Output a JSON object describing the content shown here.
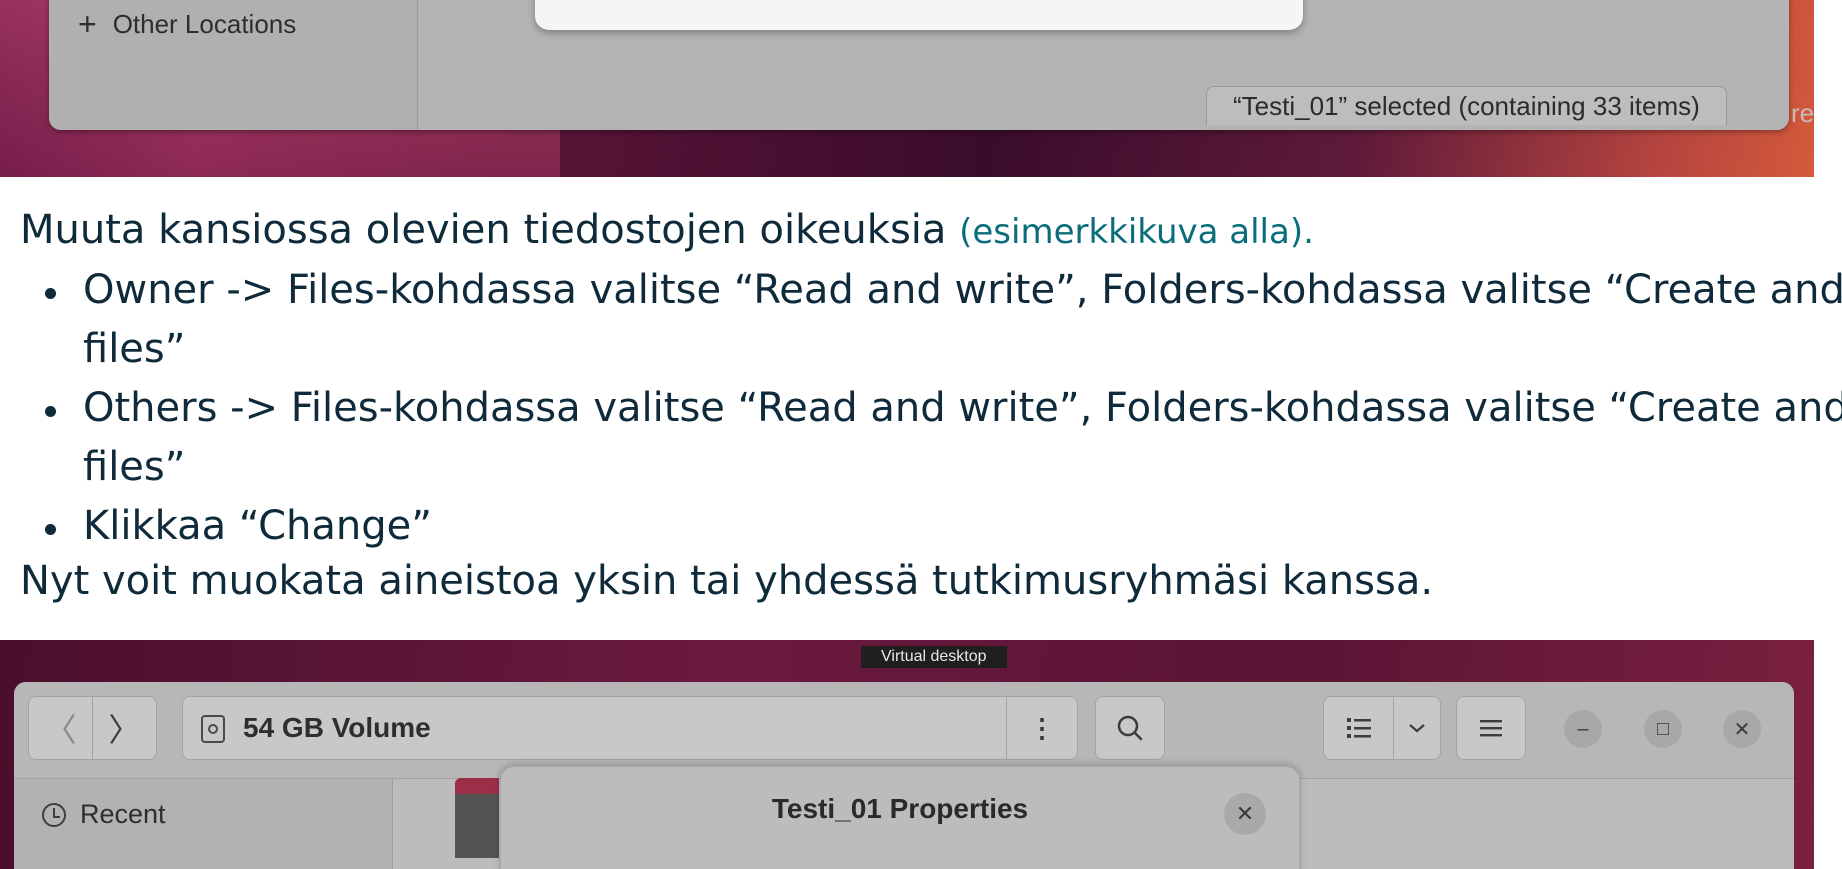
{
  "top_screenshot": {
    "sidebar_item": {
      "icon": "plus-icon",
      "label": "Other Locations"
    },
    "status_text": "“Testi_01” selected  (containing 33 items)",
    "status_tail": "re"
  },
  "instructions": {
    "intro": "Muuta kansiossa olevien tiedostojen oikeuksia ",
    "example_link": "(esimerkkikuva alla).",
    "steps": [
      {
        "line1": "Owner -> Files-kohdassa valitse “Read and write”, Folders-kohdassa valitse “Create and de",
        "line2": "files”"
      },
      {
        "line1": "Others -> Files-kohdassa valitse “Read and write”, Folders-kohdassa valitse “Create and de",
        "line2": "files”"
      },
      {
        "line1": "Klikkaa “Change”"
      }
    ],
    "outro": "Nyt voit muokata aineistoa yksin tai yhdessä tutkimusryhmäsi kanssa."
  },
  "bottom_screenshot": {
    "virtual_desktop_label": "Virtual desktop",
    "path_label": "54 GB Volume",
    "path_icon": "drive-icon",
    "sidebar_item": {
      "icon": "clock-icon",
      "label": "Recent"
    },
    "dialog_title": "Testi_01 Properties",
    "icons": {
      "back": "〈",
      "forward": "〉",
      "path_menu": "⋮",
      "minimize": "–",
      "maximize": "□",
      "close": "✕"
    }
  },
  "colors": {
    "text": "#0f2a3a",
    "link": "#0b6d7c",
    "window_gray": "#b4b4b4"
  }
}
